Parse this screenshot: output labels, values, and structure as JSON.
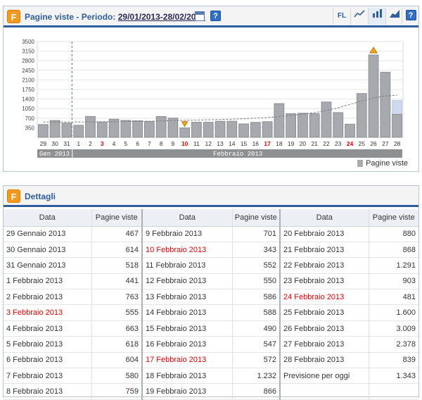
{
  "chart_panel": {
    "logo": "F",
    "title_prefix": "Pagine viste - Periodo:",
    "period": "29/01/2013-28/02/2013",
    "help": "?",
    "toolbar": {
      "fl_label": "FL",
      "icons": [
        "line-chart-icon",
        "bar-chart-icon",
        "area-chart-icon"
      ]
    },
    "legend": "Pagine viste"
  },
  "chart_data": {
    "type": "bar",
    "y_ticks": [
      350,
      700,
      1050,
      1400,
      1750,
      2100,
      2450,
      2800,
      3150,
      3500
    ],
    "ylim": [
      0,
      3500
    ],
    "categories": [
      "29",
      "30",
      "31",
      "1",
      "2",
      "3",
      "4",
      "5",
      "6",
      "7",
      "8",
      "9",
      "10",
      "11",
      "12",
      "13",
      "14",
      "15",
      "16",
      "17",
      "18",
      "19",
      "20",
      "21",
      "22",
      "23",
      "24",
      "25",
      "26",
      "27",
      "28"
    ],
    "values": [
      467,
      614,
      518,
      441,
      763,
      555,
      663,
      618,
      604,
      580,
      759,
      701,
      343,
      552,
      550,
      586,
      588,
      490,
      547,
      572,
      1232,
      866,
      880,
      868,
      1291,
      903,
      481,
      1600,
      3009,
      2378,
      839
    ],
    "forecast_last": 1343,
    "red_categories": [
      "3",
      "10",
      "17",
      "24"
    ],
    "months": [
      {
        "label": "Gen 2013",
        "from": 0,
        "to": 2
      },
      {
        "label": "Febbraio 2013",
        "from": 3,
        "to": 30
      }
    ],
    "markers": [
      {
        "index": 12,
        "type": "min"
      },
      {
        "index": 28,
        "type": "max"
      }
    ],
    "trend": [
      560,
      560,
      560,
      560,
      565,
      570,
      575,
      580,
      585,
      590,
      600,
      610,
      620,
      630,
      640,
      650,
      665,
      680,
      700,
      720,
      760,
      800,
      850,
      900,
      980,
      1080,
      1200,
      1330,
      1440,
      1510,
      1540
    ],
    "series": [
      {
        "name": "Pagine viste"
      }
    ],
    "colors": {
      "bar": "#a6a9ad",
      "bar_edge": "#8b8e92",
      "forecast": "#cfd9ee",
      "month_bar": "#8f9092"
    }
  },
  "details": {
    "logo": "F",
    "title": "Dettagli",
    "headers": [
      "Data",
      "Pagine viste",
      "Data",
      "Pagine viste",
      "Data",
      "Pagine viste"
    ],
    "rows": [
      [
        [
          "29 Gennaio 2013",
          "467",
          false
        ],
        [
          "9 Febbraio 2013",
          "701",
          false
        ],
        [
          "20 Febbraio 2013",
          "880",
          false
        ]
      ],
      [
        [
          "30 Gennaio 2013",
          "614",
          false
        ],
        [
          "10 Febbraio 2013",
          "343",
          true
        ],
        [
          "21 Febbraio 2013",
          "868",
          false
        ]
      ],
      [
        [
          "31 Gennaio 2013",
          "518",
          false
        ],
        [
          "11 Febbraio 2013",
          "552",
          false
        ],
        [
          "22 Febbraio 2013",
          "1.291",
          false
        ]
      ],
      [
        [
          "1 Febbraio 2013",
          "441",
          false
        ],
        [
          "12 Febbraio 2013",
          "550",
          false
        ],
        [
          "23 Febbraio 2013",
          "903",
          false
        ]
      ],
      [
        [
          "2 Febbraio 2013",
          "763",
          false
        ],
        [
          "13 Febbraio 2013",
          "586",
          false
        ],
        [
          "24 Febbraio 2013",
          "481",
          true
        ]
      ],
      [
        [
          "3 Febbraio 2013",
          "555",
          true
        ],
        [
          "14 Febbraio 2013",
          "588",
          false
        ],
        [
          "25 Febbraio 2013",
          "1.600",
          false
        ]
      ],
      [
        [
          "4 Febbraio 2013",
          "663",
          false
        ],
        [
          "15 Febbraio 2013",
          "490",
          false
        ],
        [
          "26 Febbraio 2013",
          "3.009",
          false
        ]
      ],
      [
        [
          "5 Febbraio 2013",
          "618",
          false
        ],
        [
          "16 Febbraio 2013",
          "547",
          false
        ],
        [
          "27 Febbraio 2013",
          "2.378",
          false
        ]
      ],
      [
        [
          "6 Febbraio 2013",
          "604",
          false
        ],
        [
          "17 Febbraio 2013",
          "572",
          true
        ],
        [
          "28 Febbraio 2013",
          "839",
          false
        ]
      ],
      [
        [
          "7 Febbraio 2013",
          "580",
          false
        ],
        [
          "18 Febbraio 2013",
          "1.232",
          false
        ],
        [
          "Previsione per oggi",
          "1.343",
          false
        ]
      ],
      [
        [
          "8 Febbraio 2013",
          "759",
          false
        ],
        [
          "19 Febbraio 2013",
          "866",
          false
        ],
        [
          "",
          "",
          " "
        ]
      ]
    ]
  }
}
